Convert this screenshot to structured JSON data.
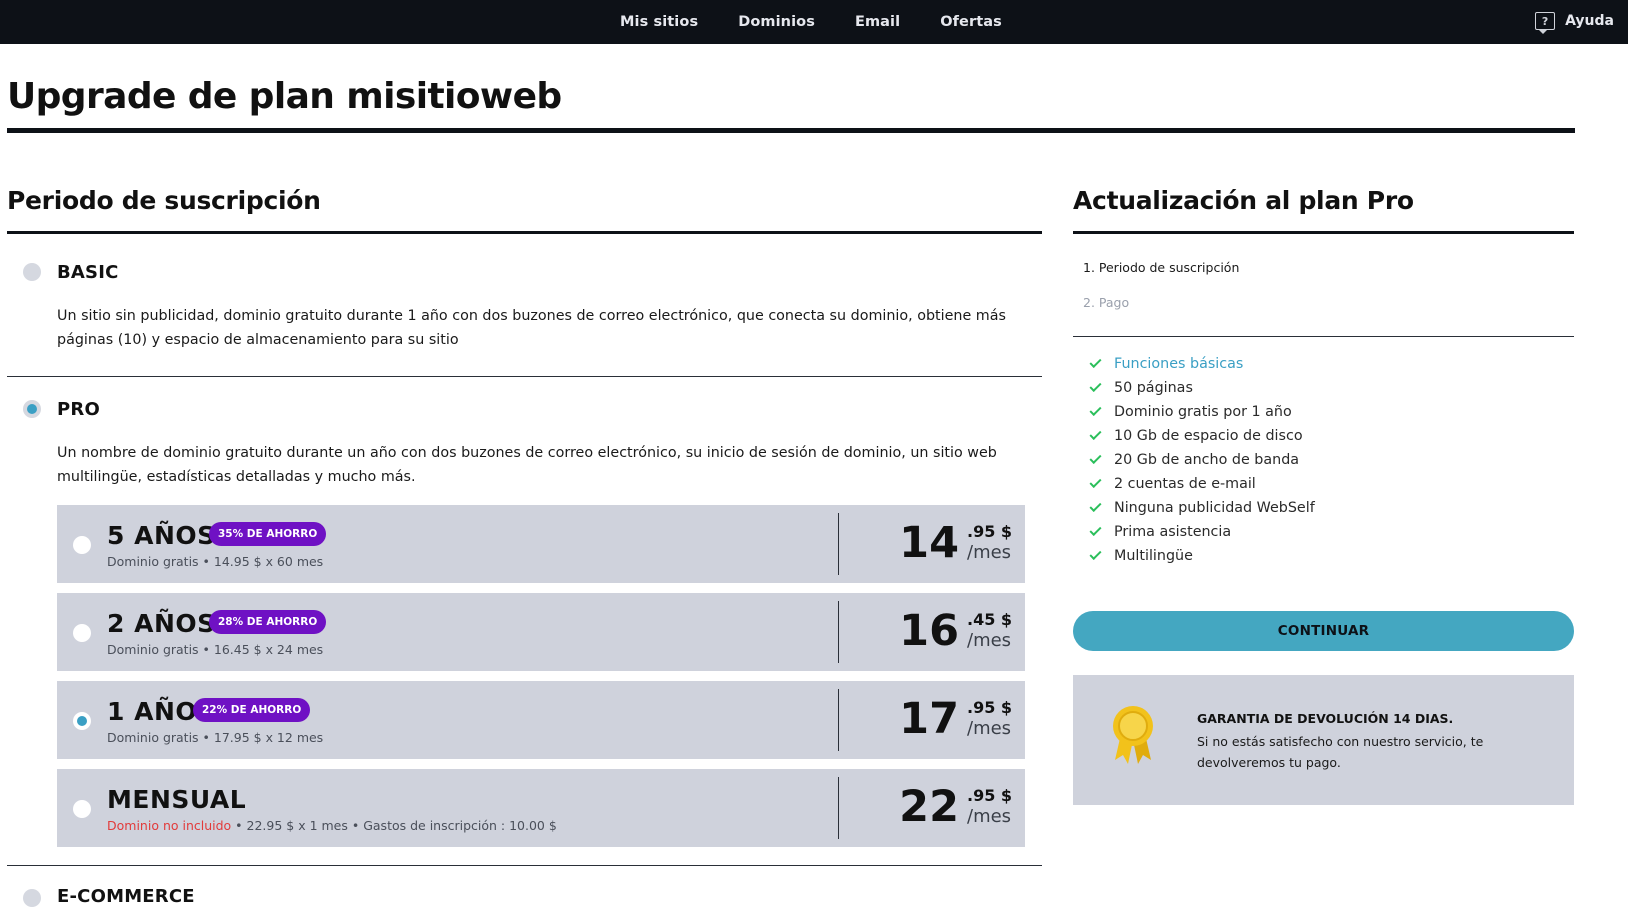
{
  "nav": {
    "items": [
      "Mis sitios",
      "Dominios",
      "Email",
      "Ofertas"
    ],
    "help_label": "Ayuda",
    "help_icon": "help-icon"
  },
  "page": {
    "title": "Upgrade de plan misitioweb"
  },
  "plans": {
    "section_title": "Periodo de suscripción",
    "sections": [
      {
        "name": "BASIC",
        "description": "Un sitio sin publicidad, dominio gratuito durante 1 año con dos buzones de correo electrónico, que conecta su dominio, obtiene más páginas (10) y espacio de almacenamiento para su sitio",
        "selected": false
      },
      {
        "name": "PRO",
        "description": "Un nombre de dominio gratuito durante un año con dos buzones de correo electrónico, su inicio de sesión de dominio, un sitio web multilingüe, estadísticas detalladas y mucho más.",
        "selected": true
      },
      {
        "name": "E-COMMERCE",
        "description": "",
        "selected": false
      }
    ],
    "options": [
      {
        "title": "5 AÑOS",
        "badge": "35% DE AHORRO",
        "sub_red": "",
        "sub": "Dominio gratis • 14.95 $ x 60 mes",
        "price_int": "14",
        "price_dec": ".95 $",
        "per": "/mes",
        "selected": false
      },
      {
        "title": "2 AÑOS",
        "badge": "28% DE AHORRO",
        "sub_red": "",
        "sub": "Dominio gratis • 16.45 $ x 24 mes",
        "price_int": "16",
        "price_dec": ".45 $",
        "per": "/mes",
        "selected": false
      },
      {
        "title": "1 AÑO",
        "badge": "22% DE AHORRO",
        "sub_red": "",
        "sub": "Dominio gratis • 17.95 $ x 12 mes",
        "price_int": "17",
        "price_dec": ".95 $",
        "per": "/mes",
        "selected": true
      },
      {
        "title": "MENSUAL",
        "badge": "",
        "sub_red": "Dominio no incluido",
        "sub": " • 22.95 $ x 1 mes • Gastos de inscripción : 10.00 $",
        "price_int": "22",
        "price_dec": ".95 $",
        "per": "/mes",
        "selected": false
      }
    ]
  },
  "sidebar": {
    "title": "Actualización al plan Pro",
    "steps": [
      "1. Periodo de suscripción",
      "2. Pago"
    ],
    "features": [
      "Funciones básicas",
      "50 páginas",
      "Dominio gratis por 1 año",
      "10 Gb de espacio de disco",
      "20 Gb de ancho de banda",
      "2 cuentas de e-mail",
      "Ninguna publicidad WebSelf",
      "Prima asistencia",
      "Multilingüe"
    ],
    "continue_label": "CONTINUAR",
    "guarantee_title": "GARANTIA DE DEVOLUCIÓN 14 DIAS.",
    "guarantee_text": "Si no estás satisfecho con nuestro servicio, te devolveremos tu pago.",
    "colors": {
      "accent": "#44a7c1",
      "badge": "#6f11c4",
      "check": "#2bbf5b",
      "warning": "#e23b3b"
    }
  }
}
